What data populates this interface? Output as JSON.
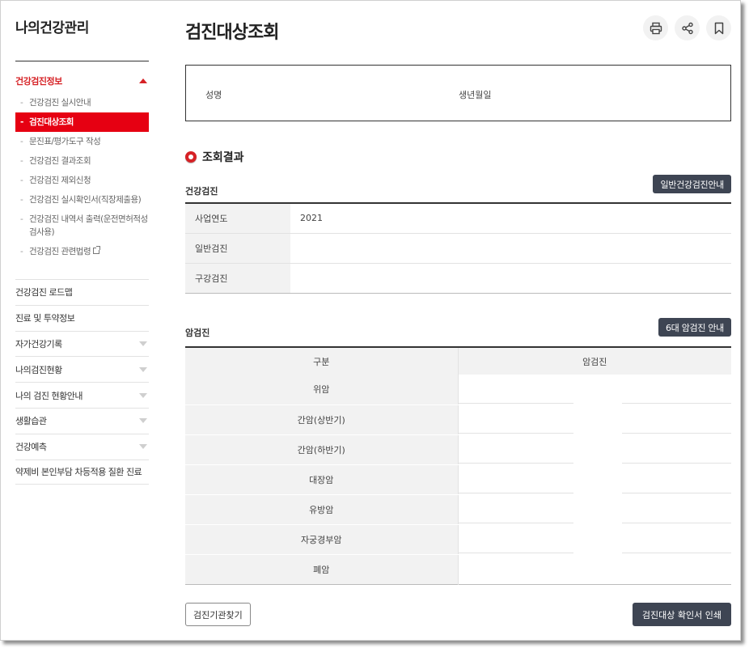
{
  "sidebar": {
    "title": "나의건강관리",
    "group": {
      "label": "건강검진정보",
      "items": [
        {
          "label": "건강검진 실시안내"
        },
        {
          "label": "검진대상조회"
        },
        {
          "label": "문진표/평가도구 작성"
        },
        {
          "label": "건강검진 결과조회"
        },
        {
          "label": "건강검진 제외신청"
        },
        {
          "label": "건강검진 실시확인서(직장제출용)"
        },
        {
          "label": "건강검진 내역서 출력(운전면허적성검사용)"
        },
        {
          "label": "건강검진 관련법령"
        }
      ]
    },
    "menu": [
      {
        "label": "건강검진 로드맵"
      },
      {
        "label": "진료 및 투약정보"
      },
      {
        "label": "자가건강기록"
      },
      {
        "label": "나의검진현황"
      },
      {
        "label": "나의 검진 현황안내"
      },
      {
        "label": "생활습관"
      },
      {
        "label": "건강예측"
      },
      {
        "label": "약제비 본인부담 차등적용 질환 진료"
      }
    ]
  },
  "main": {
    "title": "검진대상조회",
    "tools": {
      "print": "print-icon",
      "share": "share-icon",
      "bookmark": "bookmark-icon"
    },
    "info": {
      "name_label": "성명",
      "birth_label": "생년월일"
    },
    "section_title": "조회결과",
    "health": {
      "title": "건강검진",
      "guide_button": "일반건강검진안내",
      "rows": [
        {
          "label": "사업연도",
          "value": "2021"
        },
        {
          "label": "일반검진",
          "value": ""
        },
        {
          "label": "구강검진",
          "value": ""
        }
      ]
    },
    "cancer": {
      "title": "암검진",
      "guide_button": "6대 암검진 안내",
      "col_category": "구분",
      "col_value": "암검진",
      "rows": [
        {
          "label": "위암"
        },
        {
          "label": "간암(상반기)"
        },
        {
          "label": "간암(하반기)"
        },
        {
          "label": "대장암"
        },
        {
          "label": "유방암"
        },
        {
          "label": "자궁경부암"
        },
        {
          "label": "폐암"
        }
      ]
    },
    "buttons": {
      "find_org": "검진기관찾기",
      "print_confirm": "검진대상 확인서 인쇄"
    }
  },
  "colors": {
    "accent": "#e60012",
    "dark_button": "#3e4553",
    "table_header": "#f2f2f2"
  }
}
